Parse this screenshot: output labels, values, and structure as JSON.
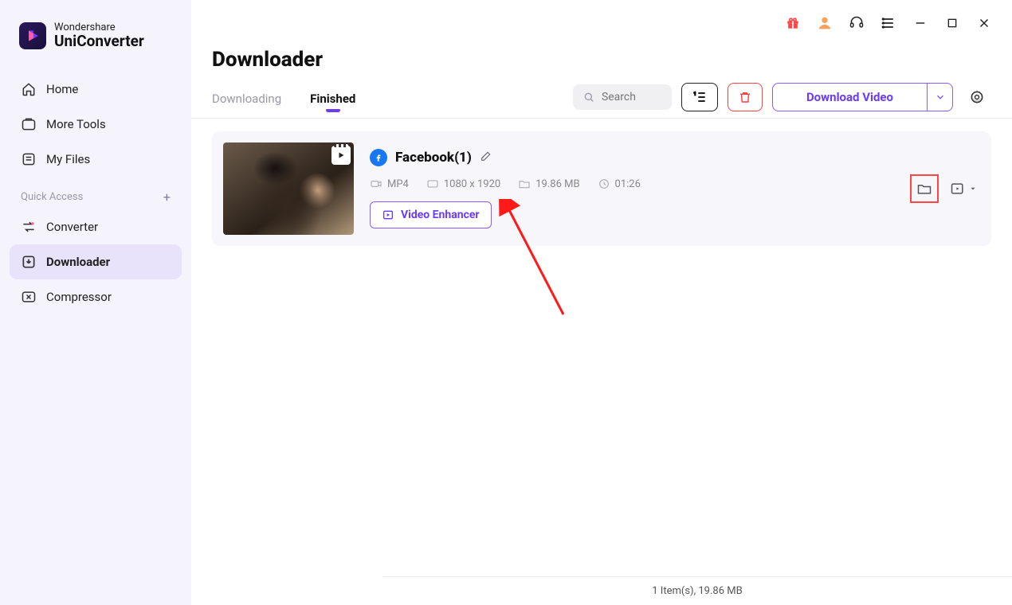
{
  "brand": {
    "maker": "Wondershare",
    "product": "UniConverter"
  },
  "sidebar": {
    "items": [
      {
        "label": "Home"
      },
      {
        "label": "More Tools"
      },
      {
        "label": "My Files"
      }
    ],
    "quick_access_label": "Quick Access",
    "qa_items": [
      {
        "label": "Converter"
      },
      {
        "label": "Downloader"
      },
      {
        "label": "Compressor"
      }
    ]
  },
  "page": {
    "title": "Downloader"
  },
  "tabs": {
    "downloading": "Downloading",
    "finished": "Finished"
  },
  "search": {
    "placeholder": "Search"
  },
  "toolbar": {
    "download_video_label": "Download Video"
  },
  "item": {
    "title": "Facebook(1)",
    "format": "MP4",
    "resolution": "1080 x 1920",
    "size": "19.86 MB",
    "duration": "01:26",
    "enhancer_label": "Video Enhancer"
  },
  "status": {
    "text": "1 Item(s), 19.86 MB"
  }
}
